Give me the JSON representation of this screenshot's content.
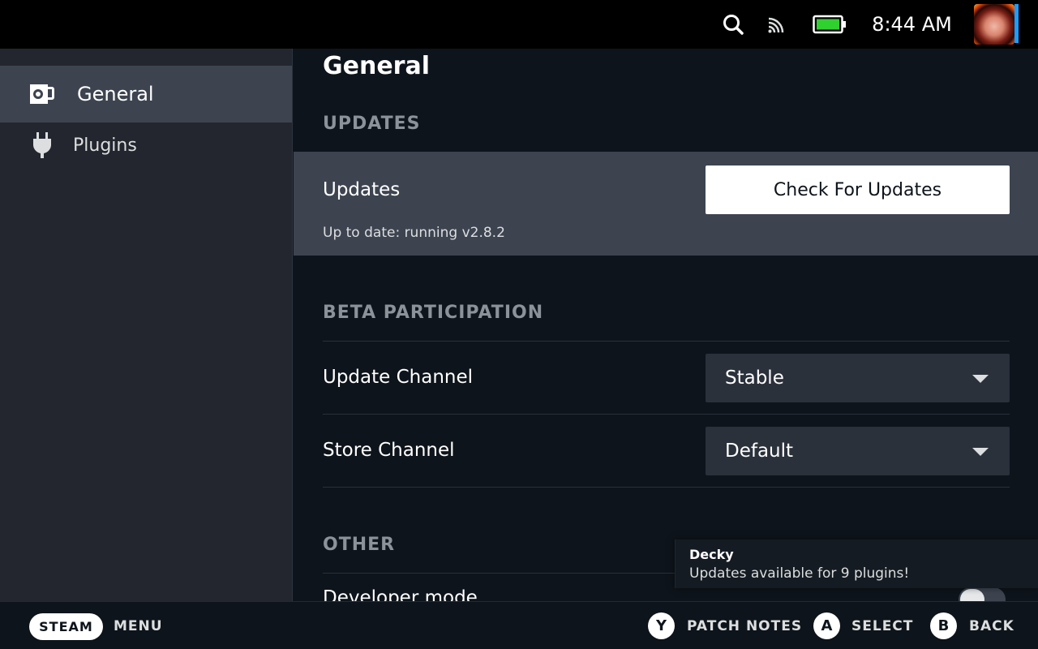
{
  "statusbar": {
    "time": "8:44 AM",
    "icons": [
      "search-icon",
      "cast-icon",
      "battery-icon"
    ],
    "battery_color": "#2fd12f"
  },
  "sidebar": {
    "items": [
      {
        "label": "General",
        "icon": "settings-page-icon",
        "active": true
      },
      {
        "label": "Plugins",
        "icon": "plug-icon",
        "active": false
      }
    ]
  },
  "main": {
    "title": "General",
    "sections": {
      "updates": {
        "heading": "UPDATES",
        "row_label": "Updates",
        "status": "Up to date: running v2.8.2",
        "button_label": "Check For Updates"
      },
      "beta": {
        "heading": "BETA PARTICIPATION",
        "update_channel_label": "Update Channel",
        "update_channel_value": "Stable",
        "store_channel_label": "Store Channel",
        "store_channel_value": "Default"
      },
      "other": {
        "heading": "OTHER",
        "developer_mode_label": "Developer mode",
        "developer_mode_enabled": false
      }
    }
  },
  "toast": {
    "title": "Decky",
    "message": "Updates available for 9 plugins!"
  },
  "footer": {
    "steam_label": "STEAM",
    "menu_label": "MENU",
    "y_key": "Y",
    "y_label": "PATCH NOTES",
    "a_key": "A",
    "a_label": "SELECT",
    "b_key": "B",
    "b_label": "BACK"
  },
  "colors": {
    "accent": "#1a9fff",
    "background": "#0e141b",
    "sidebar": "#23262e",
    "highlight": "#3d4450"
  }
}
